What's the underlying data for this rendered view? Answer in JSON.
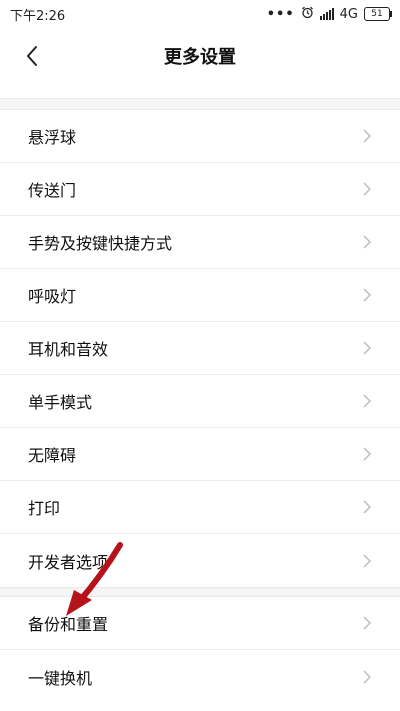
{
  "status_bar": {
    "time": "下午2:26",
    "dots": "•••",
    "network": "4G",
    "network_sub": "",
    "battery": "51",
    "icons": [
      "alarm-icon",
      "signal-icon"
    ]
  },
  "header": {
    "title": "更多设置",
    "back_icon": "chevron-left-icon"
  },
  "sections": [
    {
      "items": [
        {
          "label": "悬浮球"
        },
        {
          "label": "传送门"
        },
        {
          "label": "手势及按键快捷方式"
        },
        {
          "label": "呼吸灯"
        },
        {
          "label": "耳机和音效"
        },
        {
          "label": "单手模式"
        },
        {
          "label": "无障碍"
        },
        {
          "label": "打印"
        },
        {
          "label": "开发者选项"
        }
      ]
    },
    {
      "items": [
        {
          "label": "备份和重置"
        },
        {
          "label": "一键换机"
        }
      ]
    }
  ],
  "colors": {
    "annotation_arrow": "#b5121b",
    "section_gap": "#f5f5f5",
    "chevron": "#bdbdbd"
  }
}
